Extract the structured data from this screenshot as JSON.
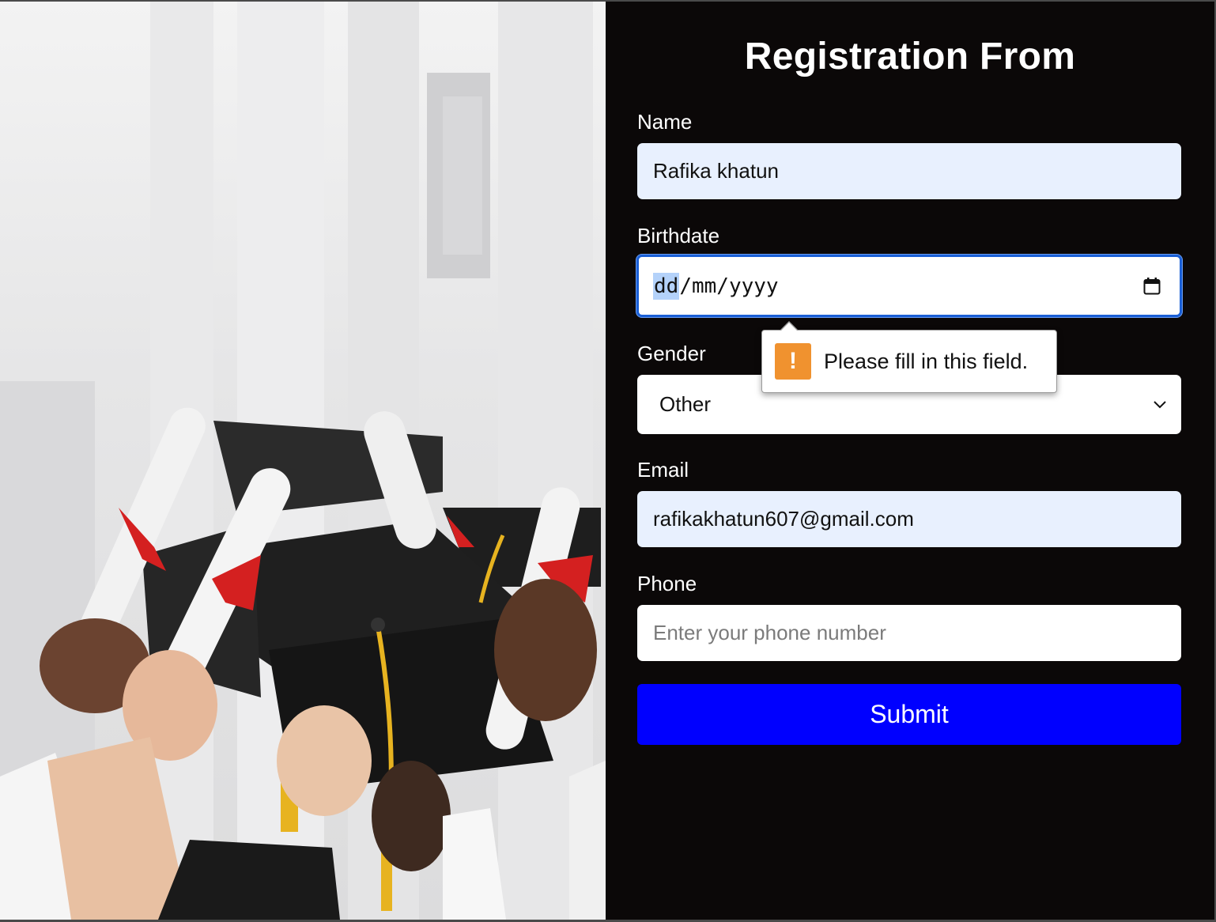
{
  "form": {
    "title": "Registration From",
    "name": {
      "label": "Name",
      "value": "Rafika khatun"
    },
    "birthdate": {
      "label": "Birthdate",
      "segments": [
        "dd",
        "mm",
        "yyyy"
      ],
      "separator": "/",
      "icon": "calendar-icon"
    },
    "gender": {
      "label": "Gender",
      "selected": "Other",
      "icon": "chevron-down-icon"
    },
    "email": {
      "label": "Email",
      "value": "rafikakhatun607@gmail.com"
    },
    "phone": {
      "label": "Phone",
      "placeholder": "Enter your phone number"
    },
    "submit_label": "Submit",
    "validation": {
      "message": "Please fill in this field.",
      "icon": "warning-icon",
      "icon_glyph": "!"
    }
  },
  "colors": {
    "panel_bg": "#0b0808",
    "submit_bg": "#0000ff",
    "autofill_bg": "#e8f0fe",
    "focus_border": "#1a5fd6",
    "warning": "#f0922f"
  },
  "image": {
    "icon": "graduation-photo"
  }
}
